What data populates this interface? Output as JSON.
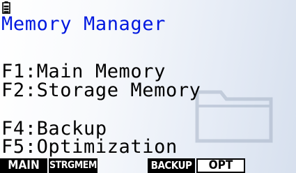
{
  "status_bar": {
    "battery_icon": "battery-icon"
  },
  "title": "Memory Manager",
  "menu": {
    "f1": "F1:Main Memory",
    "f2": "F2:Storage Memory",
    "f4": "F4:Backup",
    "f5": "F5:Optimization"
  },
  "function_keys": {
    "f1": "MAIN",
    "f2": "STRGMEM",
    "f4": "BACKUP",
    "f5": "OPT"
  },
  "colors": {
    "title": "#0018e0",
    "text": "#000000",
    "background_right": "#d7e0ee"
  },
  "background_icon": "folder-icon"
}
